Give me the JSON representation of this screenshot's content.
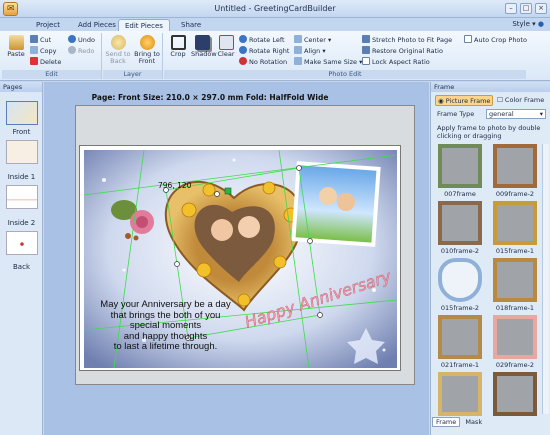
{
  "window": {
    "title": "Untitled - GreetingCardBuilder"
  },
  "tabs": [
    {
      "label": "Project"
    },
    {
      "label": "Add Pieces"
    },
    {
      "label": "Edit Pieces"
    },
    {
      "label": "Share"
    }
  ],
  "style_menu": "Style",
  "ribbon": {
    "edit": {
      "label": "Edit",
      "paste": "Paste",
      "cut": "Cut",
      "copy": "Copy",
      "delete": "Delete",
      "undo": "Undo",
      "redo": "Redo"
    },
    "layer": {
      "label": "Layer",
      "send_back": "Send to Back",
      "bring_front": "Bring to Front"
    },
    "photo_edit": {
      "label": "Photo Edit",
      "crop": "Crop",
      "shadow": "Shadow",
      "clear": "Clear",
      "rotate_left": "Rotate Left",
      "rotate_right": "Rotate Right",
      "no_rotation": "No Rotation",
      "center": "Center",
      "align": "Align",
      "make_same_size": "Make Same Size",
      "stretch": "Stretch Photo to Fit Page",
      "auto_crop": "Auto Crop Photo",
      "restore": "Restore Original Ratio",
      "lock": "Lock Aspect Ratio"
    }
  },
  "pages_panel": {
    "title": "Pages",
    "items": [
      {
        "label": "Front"
      },
      {
        "label": "Inside 1"
      },
      {
        "label": "Inside 2"
      },
      {
        "label": "Back"
      }
    ]
  },
  "canvas": {
    "page_info": "Page: Front  Size: 210.0 × 297.0 mm  Fold: HalfFold Wide",
    "coord": "796, 120",
    "message": [
      "May your Anniversary be a day",
      "that brings the both of you",
      "special moments",
      "and happy thoughts",
      "to last a lifetime through."
    ],
    "headline": "Happy Anniversary"
  },
  "frame_panel": {
    "title": "Frame",
    "tab_picture": "Picture Frame",
    "tab_color": "Color Frame",
    "type_label": "Frame Type",
    "type_value": "general",
    "hint": "Apply frame to photo by double clicking or dragging",
    "frames": [
      {
        "name": "007frame",
        "color": "#6f8b58"
      },
      {
        "name": "009frame-2",
        "color": "#a06a3a"
      },
      {
        "name": "010frame-2",
        "color": "#8a6a4a"
      },
      {
        "name": "015frame-1",
        "color": "#c79a3a"
      },
      {
        "name": "015frame-2",
        "color": "#8fb0d8"
      },
      {
        "name": "018frame-1",
        "color": "#b8893f"
      },
      {
        "name": "021frame-1",
        "color": "#b38a4a"
      },
      {
        "name": "029frame-2",
        "color": "#e6a8a0"
      },
      {
        "name": "",
        "color": "#d6b46a"
      },
      {
        "name": "",
        "color": "#7a5a3a"
      }
    ]
  },
  "bottom_tabs": {
    "frame": "Frame",
    "mask": "Mask"
  }
}
